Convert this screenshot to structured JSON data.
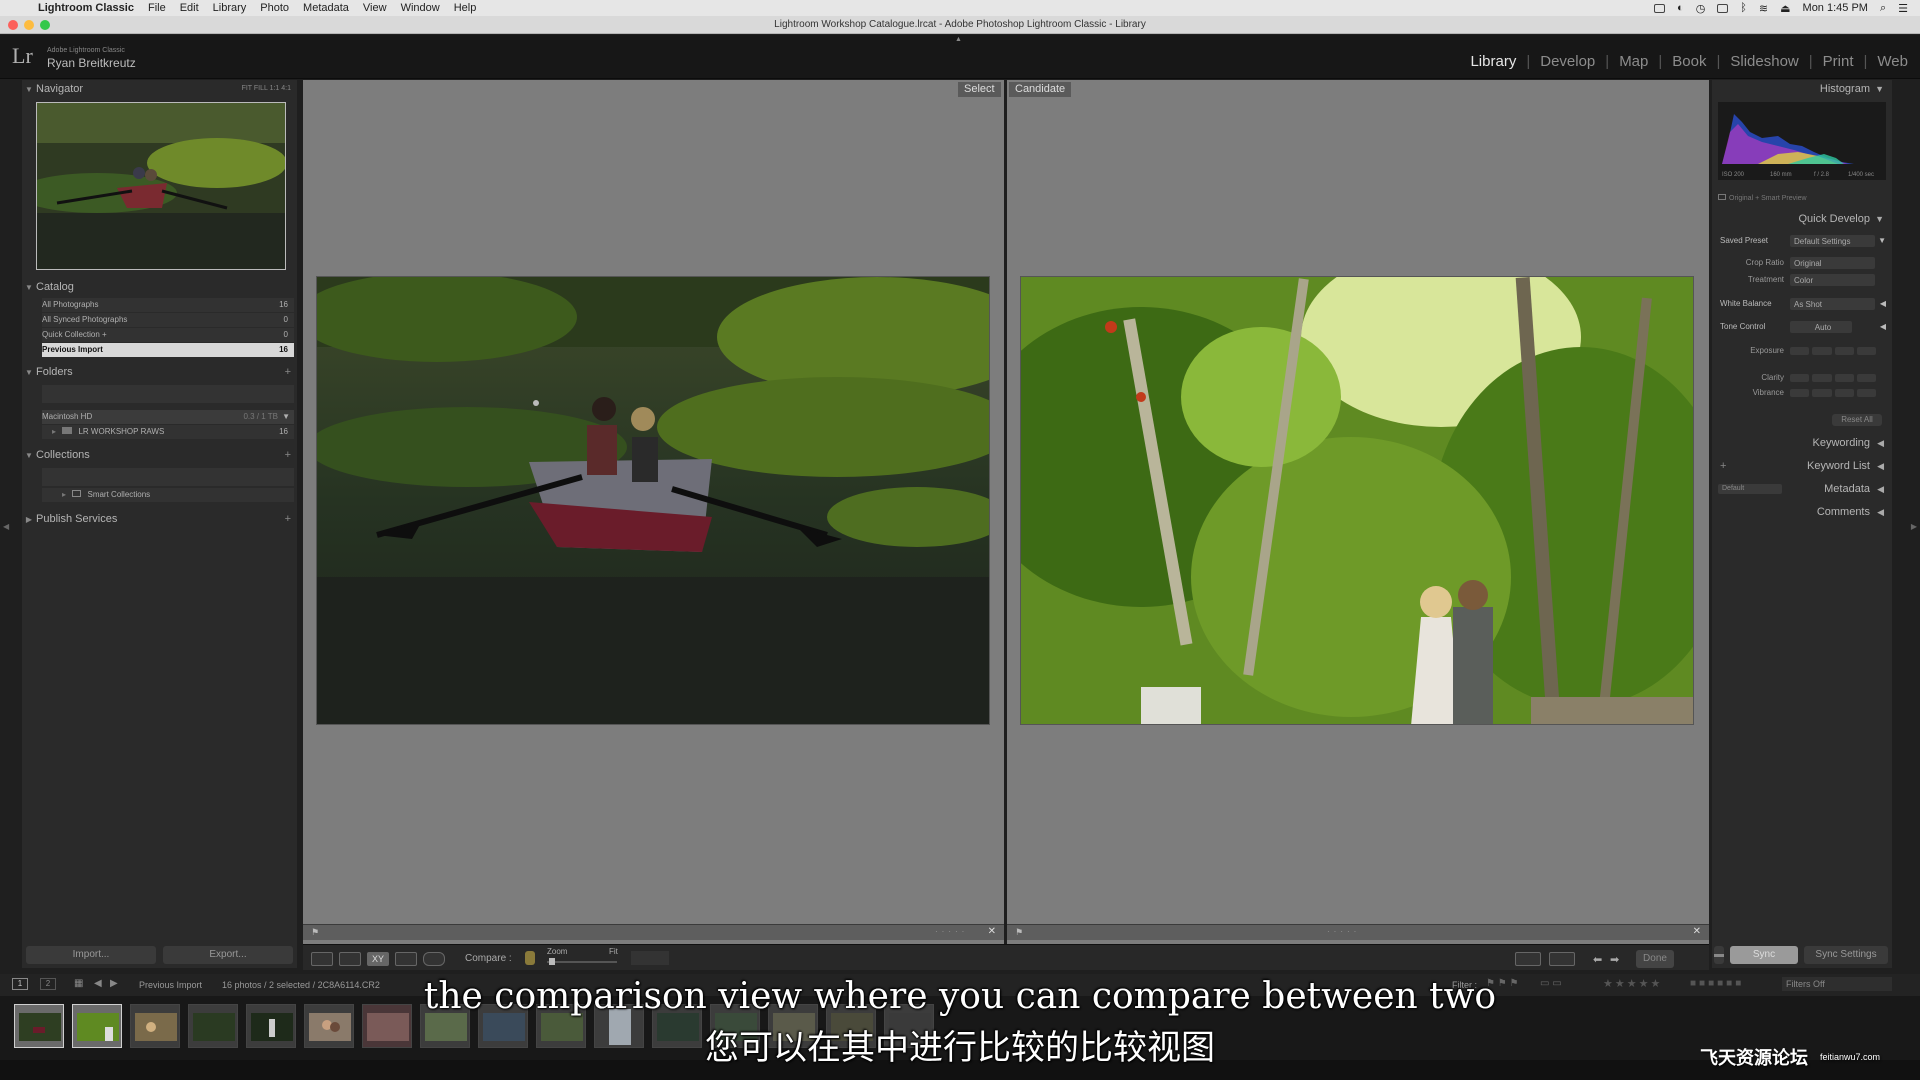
{
  "menubar": {
    "app_name": "Lightroom Classic",
    "items": [
      "File",
      "Edit",
      "Library",
      "Photo",
      "Metadata",
      "View",
      "Window",
      "Help"
    ],
    "clock": "Mon 1:45 PM"
  },
  "window_title": "Lightroom Workshop Catalogue.lrcat - Adobe Photoshop Lightroom Classic - Library",
  "identity": {
    "logo": "Lr",
    "product": "Adobe Lightroom Classic",
    "user": "Ryan Breitkreutz"
  },
  "modules": [
    "Library",
    "Develop",
    "Map",
    "Book",
    "Slideshow",
    "Print",
    "Web"
  ],
  "active_module": "Library",
  "left_panel": {
    "navigator": {
      "title": "Navigator",
      "zoom_options": "FIT  FILL  1:1  4:1"
    },
    "catalog": {
      "title": "Catalog",
      "items": [
        {
          "label": "All Photographs",
          "count": "16"
        },
        {
          "label": "All Synced Photographs",
          "count": "0"
        },
        {
          "label": "Quick Collection +",
          "count": "0"
        },
        {
          "label": "Previous Import",
          "count": "16"
        }
      ]
    },
    "folders": {
      "title": "Folders",
      "volume": "Macintosh HD",
      "volume_size": "0.3 / 1 TB",
      "folder": "LR WORKSHOP RAWS",
      "folder_count": "16"
    },
    "collections": {
      "title": "Collections",
      "items": [
        "Smart Collections"
      ]
    },
    "publish": {
      "title": "Publish Services"
    },
    "import_label": "Import...",
    "export_label": "Export..."
  },
  "center": {
    "select_label": "Select",
    "candidate_label": "Candidate"
  },
  "toolbar": {
    "compare_label": "Compare :",
    "zoom_label": "Zoom",
    "fit_label": "Fit",
    "done_label": "Done"
  },
  "right_panel": {
    "histogram": {
      "title": "Histogram",
      "iso": "ISO 200",
      "focal": "160 mm",
      "aperture": "f / 2.8",
      "shutter": "1/400 sec",
      "preview_note": "Original + Smart Preview"
    },
    "quick_develop": {
      "title": "Quick Develop",
      "saved_preset_label": "Saved Preset",
      "saved_preset_value": "Default Settings",
      "crop_label": "Crop Ratio",
      "crop_value": "Original",
      "treatment_label": "Treatment",
      "treatment_value": "Color",
      "wb_label": "White Balance",
      "wb_value": "As Shot",
      "tone_label": "Tone Control",
      "tone_value": "Auto",
      "exposure_label": "Exposure",
      "clarity_label": "Clarity",
      "vibrance_label": "Vibrance",
      "reset_label": "Reset All"
    },
    "keywording": "Keywording",
    "keyword_list": "Keyword List",
    "metadata": "Metadata",
    "metadata_preset": "Default",
    "comments": "Comments",
    "sync_label": "Sync",
    "sync_settings_label": "Sync Settings"
  },
  "filmstrip": {
    "source": "Previous Import",
    "info": "16 photos / 2 selected / 2C8A6114.CR2",
    "filter_label": "Filter :",
    "filters_off": "Filters Off",
    "page1": "1",
    "page2": "2"
  },
  "subtitles": {
    "english": "the comparison view where you can compare between two",
    "chinese": "您可以在其中进行比较的比较视图"
  },
  "watermark": {
    "text": "飞天资源论坛",
    "domain": "feitianwu7.com"
  }
}
